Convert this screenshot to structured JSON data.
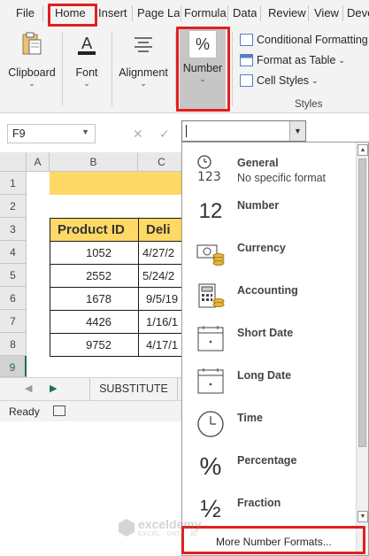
{
  "ribbon_tabs": [
    "File",
    "Home",
    "Insert",
    "Page La",
    "Formula",
    "Data",
    "Review",
    "View",
    "Deve"
  ],
  "ribbon_groups": {
    "clipboard": "Clipboard",
    "font": "Font",
    "alignment": "Alignment",
    "number": "Number",
    "number_icon": "%",
    "font_icon": "A"
  },
  "styles": {
    "conditional_formatting": "Conditional Formatting",
    "format_as_table": "Format as Table",
    "cell_styles": "Cell Styles",
    "group_label": "Styles"
  },
  "name_box": {
    "value": "F9"
  },
  "grid": {
    "col_headers": [
      "A",
      "B",
      "C"
    ],
    "row_headers": [
      "1",
      "2",
      "3",
      "4",
      "5",
      "6",
      "7",
      "8",
      "9"
    ],
    "selected_row": "9",
    "header_product": "Product ID",
    "header_delivery": "Deli",
    "rows": [
      {
        "id": "1052",
        "date": "4/27/2"
      },
      {
        "id": "2552",
        "date": "5/24/2"
      },
      {
        "id": "1678",
        "date": "9/5/19"
      },
      {
        "id": "4426",
        "date": "1/16/1"
      },
      {
        "id": "9752",
        "date": "4/17/1"
      }
    ]
  },
  "sheet_tab": "SUBSTITUTE",
  "status": "Ready",
  "number_format": {
    "input_value": "",
    "items": [
      {
        "name": "General",
        "sub": "No specific format",
        "icon": "clock-123-icon"
      },
      {
        "name": "Number",
        "sub": "",
        "icon_text": "12",
        "icon": "number-12-icon"
      },
      {
        "name": "Currency",
        "sub": "",
        "icon": "currency-icon"
      },
      {
        "name": "Accounting",
        "sub": "",
        "icon": "accounting-icon"
      },
      {
        "name": "Short Date",
        "sub": "",
        "icon": "short-date-icon"
      },
      {
        "name": "Long Date",
        "sub": "",
        "icon": "long-date-icon"
      },
      {
        "name": "Time",
        "sub": "",
        "icon": "clock-icon"
      },
      {
        "name": "Percentage",
        "sub": "",
        "icon_text": "%",
        "icon": "percent-icon"
      },
      {
        "name": "Fraction",
        "sub": "",
        "icon_text": "½",
        "icon": "fraction-icon"
      }
    ],
    "more": "More Number Formats..."
  },
  "watermark": {
    "name": "exceldemy",
    "tag": "EXCEL · DATA · BI"
  },
  "colors": {
    "highlight_red": "#e0201f",
    "header_yellow": "#ffd966",
    "excel_green": "#217346"
  }
}
